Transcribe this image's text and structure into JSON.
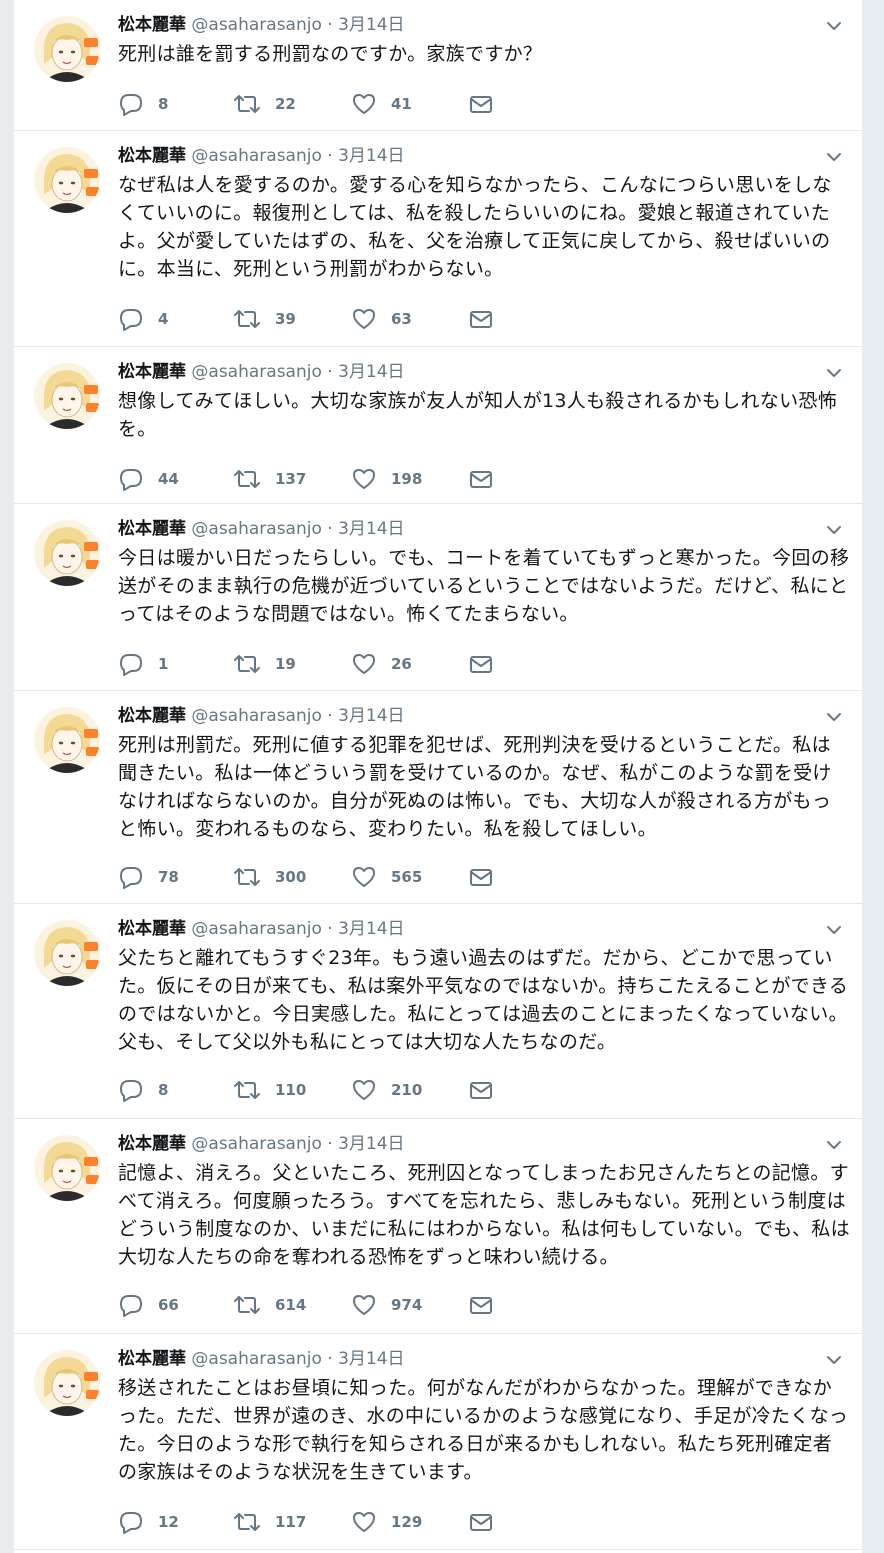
{
  "colors": {
    "background": "#e6ecf0",
    "card": "#ffffff",
    "text": "#14171a",
    "muted": "#657786",
    "accent": "#ff7f2a"
  },
  "icons": {
    "reply": "reply-icon",
    "retweet": "retweet-icon",
    "like": "heart-icon",
    "message": "envelope-icon",
    "menu": "chevron-down-icon"
  },
  "tweets": [
    {
      "name": "松本麗華",
      "handle": "@asaharasanjo",
      "separator": "·",
      "date": "3月14日",
      "text": "死刑は誰を罰する刑罰なのですか。家族ですか？",
      "replies": "8",
      "retweets": "22",
      "likes": "41"
    },
    {
      "name": "松本麗華",
      "handle": "@asaharasanjo",
      "separator": "·",
      "date": "3月14日",
      "text": "なぜ私は人を愛するのか。愛する心を知らなかったら、こんなにつらい思いをしなくていいのに。報復刑としては、私を殺したらいいのにね。愛娘と報道されていたよ。父が愛していたはずの、私を、父を治療して正気に戻してから、殺せばいいのに。本当に、死刑という刑罰がわからない。",
      "replies": "4",
      "retweets": "39",
      "likes": "63"
    },
    {
      "name": "松本麗華",
      "handle": "@asaharasanjo",
      "separator": "·",
      "date": "3月14日",
      "text": "想像してみてほしい。大切な家族が友人が知人が13人も殺されるかもしれない恐怖を。",
      "replies": "44",
      "retweets": "137",
      "likes": "198"
    },
    {
      "name": "松本麗華",
      "handle": "@asaharasanjo",
      "separator": "·",
      "date": "3月14日",
      "text": "今日は暖かい日だったらしい。でも、コートを着ていてもずっと寒かった。今回の移送がそのまま執行の危機が近づいているということではないようだ。だけど、私にとってはそのような問題ではない。怖くてたまらない。",
      "replies": "1",
      "retweets": "19",
      "likes": "26"
    },
    {
      "name": "松本麗華",
      "handle": "@asaharasanjo",
      "separator": "·",
      "date": "3月14日",
      "text": "死刑は刑罰だ。死刑に値する犯罪を犯せば、死刑判決を受けるということだ。私は聞きたい。私は一体どういう罰を受けているのか。なぜ、私がこのような罰を受けなければならないのか。自分が死ぬのは怖い。でも、大切な人が殺される方がもっと怖い。変われるものなら、変わりたい。私を殺してほしい。",
      "replies": "78",
      "retweets": "300",
      "likes": "565"
    },
    {
      "name": "松本麗華",
      "handle": "@asaharasanjo",
      "separator": "·",
      "date": "3月14日",
      "text": "父たちと離れてもうすぐ23年。もう遠い過去のはずだ。だから、どこかで思っていた。仮にその日が来ても、私は案外平気なのではないか。持ちこたえることができるのではないかと。今日実感した。私にとっては過去のことにまったくなっていない。父も、そして父以外も私にとっては大切な人たちなのだ。",
      "replies": "8",
      "retweets": "110",
      "likes": "210"
    },
    {
      "name": "松本麗華",
      "handle": "@asaharasanjo",
      "separator": "·",
      "date": "3月14日",
      "text": "記憶よ、消えろ。父といたころ、死刑囚となってしまったお兄さんたちとの記憶。すべて消えろ。何度願ったろう。すべてを忘れたら、悲しみもない。死刑という制度はどういう制度なのか、いまだに私にはわからない。私は何もしていない。でも、私は大切な人たちの命を奪われる恐怖をずっと味わい続ける。",
      "replies": "66",
      "retweets": "614",
      "likes": "974"
    },
    {
      "name": "松本麗華",
      "handle": "@asaharasanjo",
      "separator": "·",
      "date": "3月14日",
      "text": "移送されたことはお昼頃に知った。何がなんだがわからなかった。理解ができなかった。ただ、世界が遠のき、水の中にいるかのような感覚になり、手足が冷たくなった。今日のような形で執行を知らされる日が来るかもしれない。私たち死刑確定者の家族はそのような状況を生きています。",
      "replies": "12",
      "retweets": "117",
      "likes": "129"
    }
  ]
}
